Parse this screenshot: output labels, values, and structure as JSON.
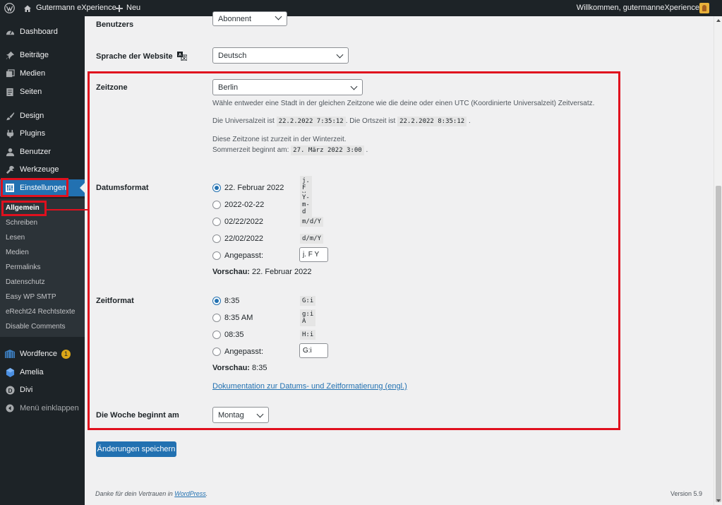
{
  "adminbar": {
    "site_name": "Gutermann eXperience",
    "new_label": "Neu",
    "howdy": "Willkommen, gutermanneXperience"
  },
  "sidebar": {
    "items": [
      {
        "label": "Dashboard",
        "icon": "dashboard-icon"
      },
      {
        "label": "Beiträge",
        "icon": "pin-icon"
      },
      {
        "label": "Medien",
        "icon": "media-icon"
      },
      {
        "label": "Seiten",
        "icon": "pages-icon"
      },
      {
        "label": "Design",
        "icon": "brush-icon"
      },
      {
        "label": "Plugins",
        "icon": "plugin-icon"
      },
      {
        "label": "Benutzer",
        "icon": "user-icon"
      },
      {
        "label": "Werkzeuge",
        "icon": "wrench-icon"
      },
      {
        "label": "Einstellungen",
        "icon": "settings-icon"
      }
    ],
    "submenu": [
      "Allgemein",
      "Schreiben",
      "Lesen",
      "Medien",
      "Permalinks",
      "Datenschutz",
      "Easy WP SMTP",
      "eRecht24 Rechtstexte",
      "Disable Comments"
    ],
    "extra": [
      {
        "label": "Wordfence",
        "badge": "1"
      },
      {
        "label": "Amelia"
      },
      {
        "label": "Divi"
      },
      {
        "label": "Menü einklappen"
      }
    ]
  },
  "form": {
    "role_label": "Benutzers",
    "role_value": "Abonnent",
    "language_label": "Sprache der Website",
    "language_value": "Deutsch",
    "timezone_label": "Zeitzone",
    "timezone_value": "Berlin",
    "timezone_desc": "Wähle entweder eine Stadt in der gleichen Zeitzone wie die deine oder einen UTC (Koordinierte Universalzeit) Zeitversatz.",
    "utc_prefix": "Die Universalzeit ist",
    "utc_value": "22.2.2022 7:35:12",
    "local_prefix": ". Die Ortszeit ist",
    "local_value": "22.2.2022 8:35:12",
    "period": ".",
    "winter_text": "Diese Zeitzone ist zurzeit in der Winterzeit.",
    "summer_prefix": "Sommerzeit beginnt am:",
    "summer_value": "27. März 2022 3:00",
    "date_label": "Datumsformat",
    "date_options": [
      {
        "label": "22. Februar 2022",
        "code": "j. F Y",
        "checked": true
      },
      {
        "label": "2022-02-22",
        "code": "Y-m-d"
      },
      {
        "label": "02/22/2022",
        "code": "m/d/Y"
      },
      {
        "label": "22/02/2022",
        "code": "d/m/Y"
      }
    ],
    "custom_label": "Angepasst:",
    "date_custom_value": "j. F Y",
    "preview_label": "Vorschau:",
    "date_preview": "22. Februar 2022",
    "time_label": "Zeitformat",
    "time_options": [
      {
        "label": "8:35",
        "code": "G:i",
        "checked": true
      },
      {
        "label": "8:35 AM",
        "code": "g:i A"
      },
      {
        "label": "08:35",
        "code": "H:i"
      }
    ],
    "time_custom_value": "G:i",
    "time_preview": "8:35",
    "doc_link": "Dokumentation zur Datums- und Zeitformatierung (engl.)",
    "week_label": "Die Woche beginnt am",
    "week_value": "Montag",
    "save_label": "Änderungen speichern"
  },
  "footer": {
    "thanks_prefix": "Danke für dein Vertrauen in",
    "thanks_link": "WordPress",
    "thanks_suffix": ".",
    "version": "Version 5.9"
  },
  "colors": {
    "accent": "#2271b1",
    "highlight": "#e0101e",
    "sidebar": "#1d2327"
  }
}
